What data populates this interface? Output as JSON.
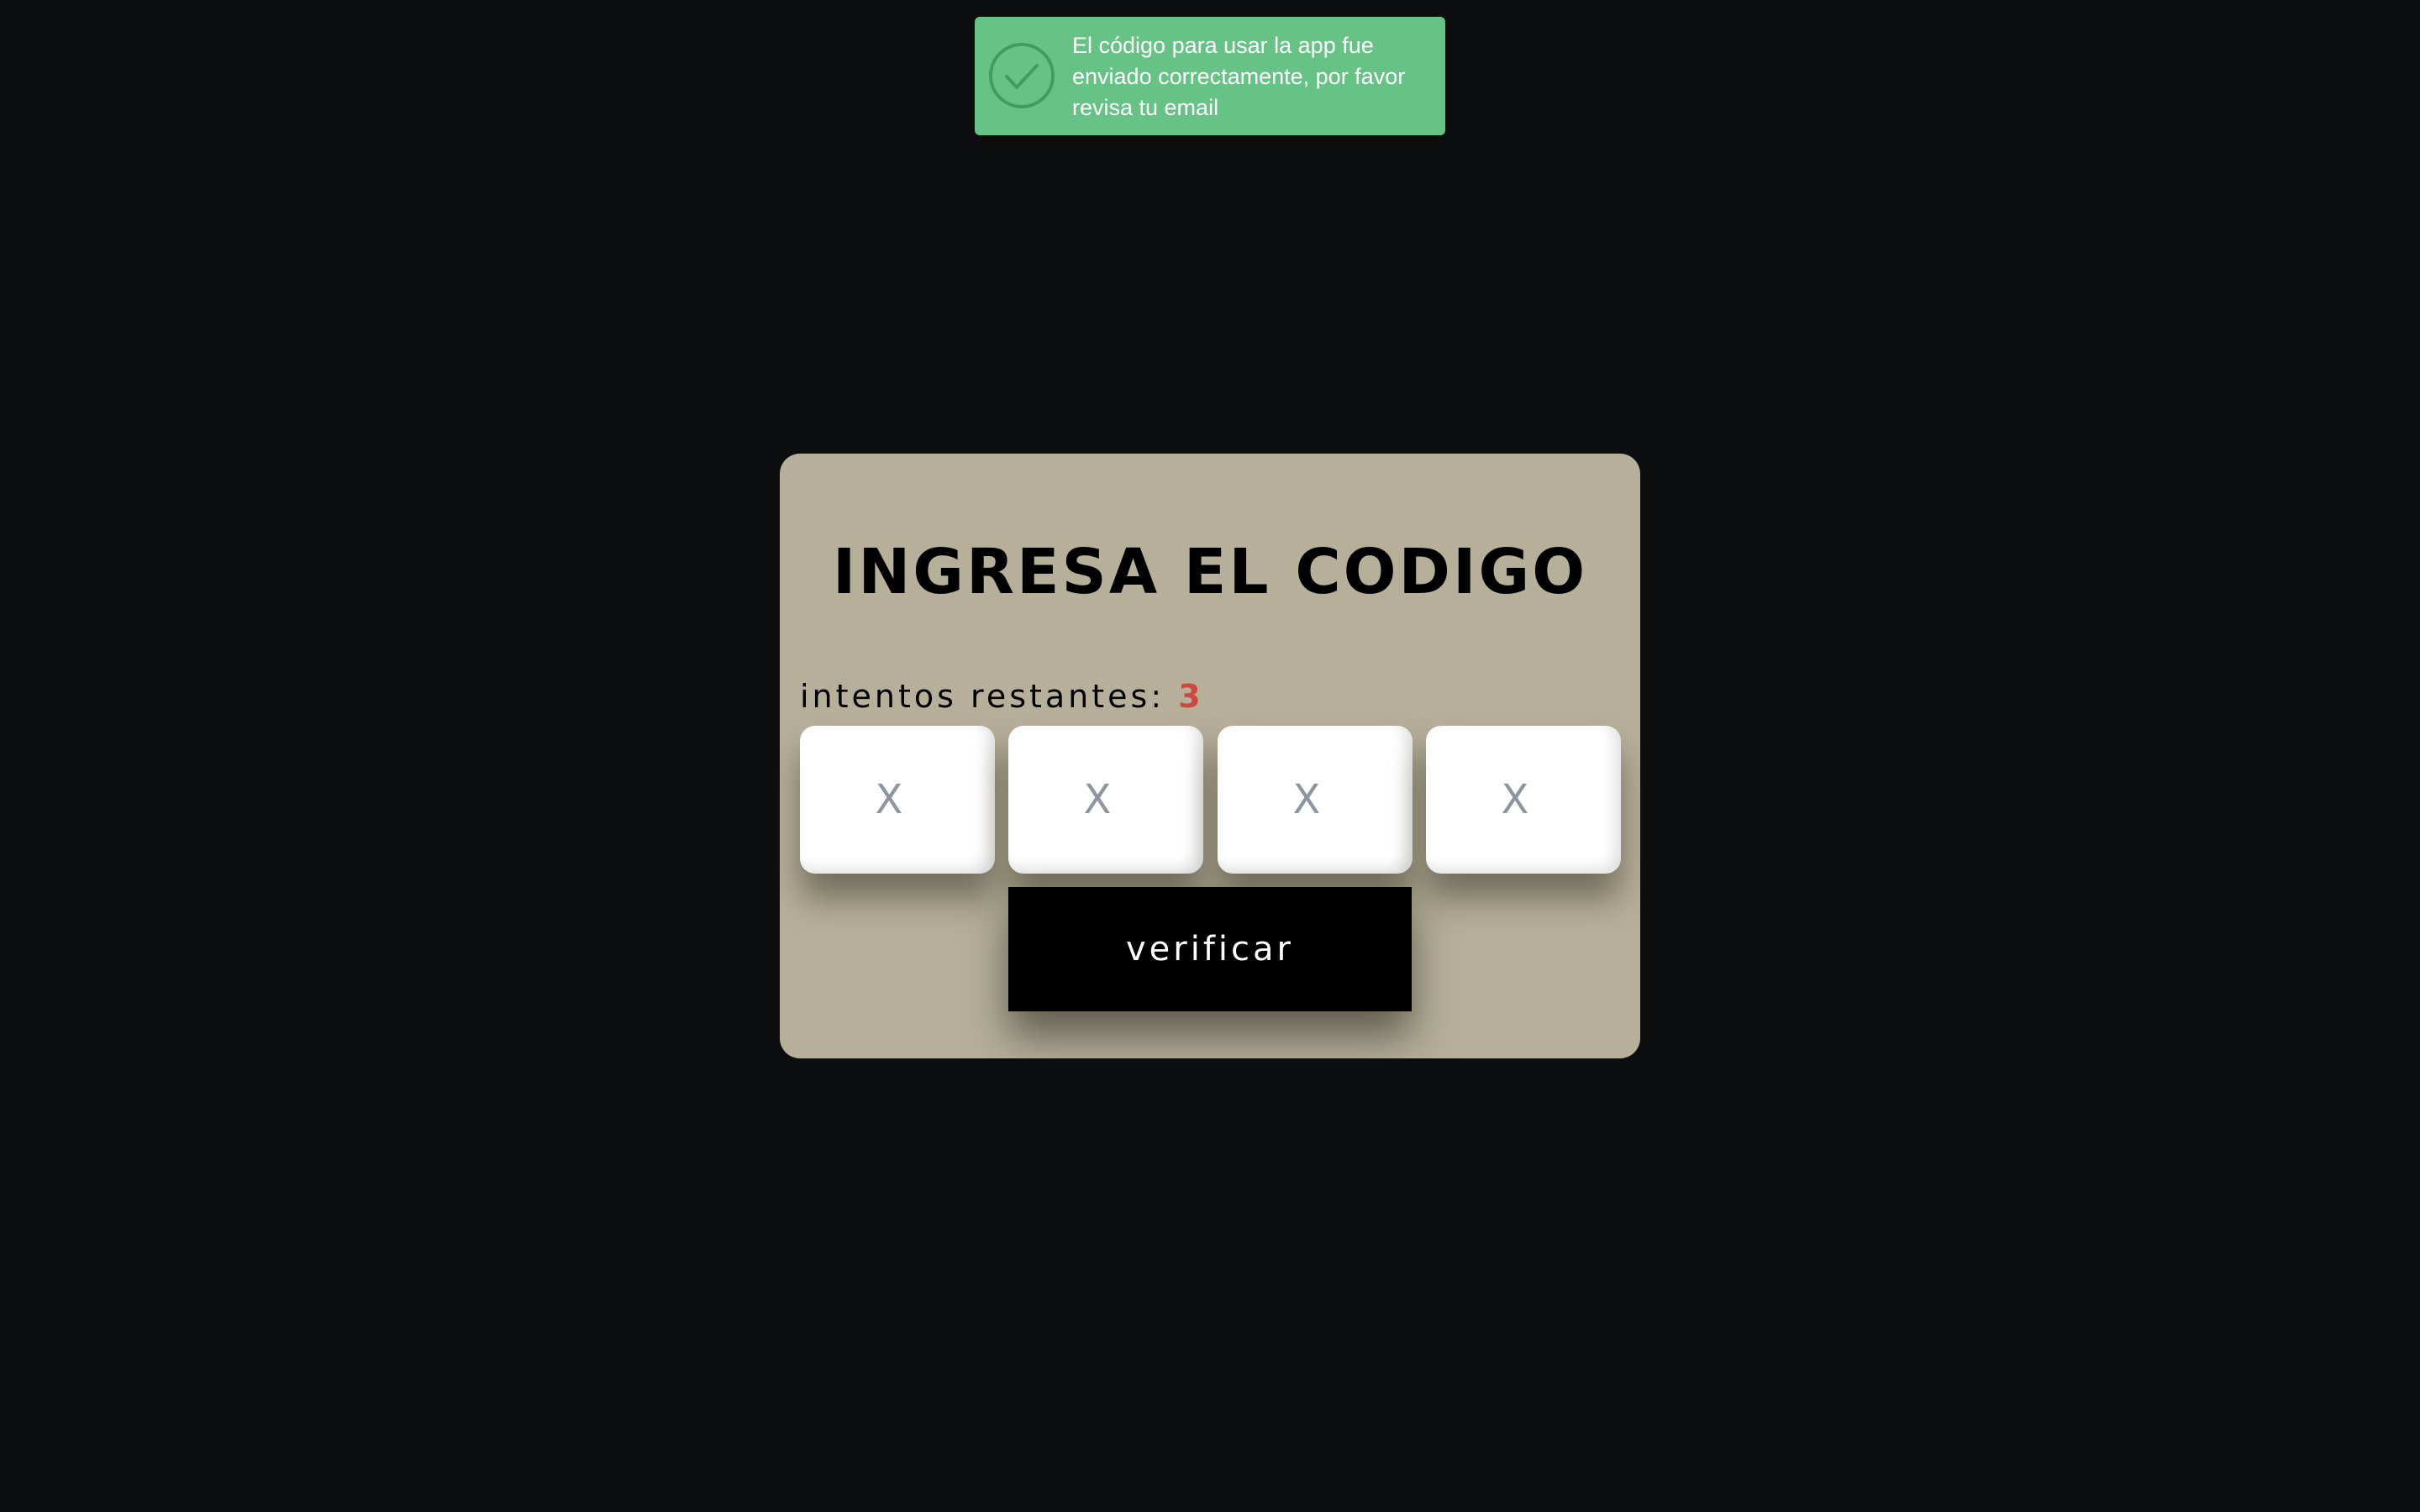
{
  "toast": {
    "icon": "check-circle-icon",
    "message": "El código para usar la app fue enviado correctamente, por favor revisa tu email",
    "background_color": "#66c385"
  },
  "card": {
    "title": "INGRESA EL CODIGO",
    "attempts_label": "intentos restantes: ",
    "attempts_count": "3",
    "attempts_count_color": "#d0473d",
    "background_color": "#b6b09b",
    "code_inputs": [
      {
        "placeholder": "X",
        "value": ""
      },
      {
        "placeholder": "X",
        "value": ""
      },
      {
        "placeholder": "X",
        "value": ""
      },
      {
        "placeholder": "X",
        "value": ""
      }
    ],
    "verify_label": "verificar"
  }
}
